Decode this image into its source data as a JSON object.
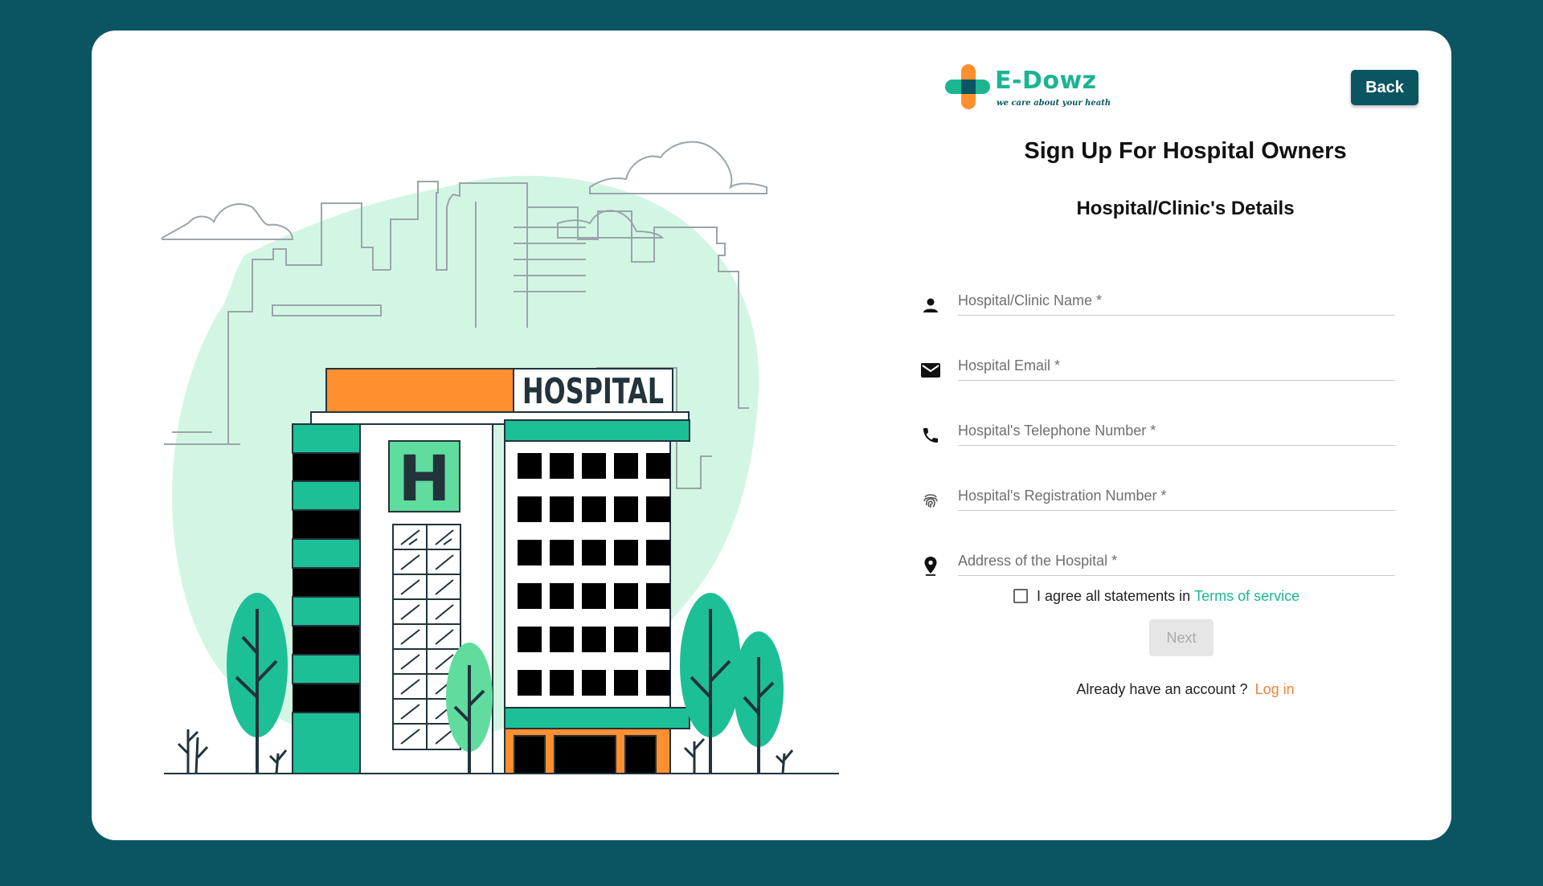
{
  "illustration": {
    "sign_text": "HOSPITAL",
    "h_letter": "H",
    "colors": {
      "teal": "#1dbf96",
      "mint": "#d3f6e4",
      "orange": "#ff8f2f",
      "dark": "#22333b",
      "black": "#000000"
    }
  },
  "brand": {
    "name": "E-Dowz",
    "tagline": "we care about your heath",
    "colors": {
      "teal": "#1bb592",
      "orange": "#ff8f2f",
      "navy": "#0b5563"
    }
  },
  "header": {
    "back_label": "Back"
  },
  "form": {
    "title": "Sign Up For Hospital Owners",
    "section_title": "Hospital/Clinic's Details",
    "fields": [
      {
        "icon": "person-icon",
        "placeholder": "Hospital/Clinic Name *",
        "value": ""
      },
      {
        "icon": "mail-icon",
        "placeholder": "Hospital Email *",
        "value": ""
      },
      {
        "icon": "phone-icon",
        "placeholder": "Hospital's Telephone Number *",
        "value": ""
      },
      {
        "icon": "fingerprint-icon",
        "placeholder": "Hospital's Registration Number *",
        "value": ""
      },
      {
        "icon": "location-pin-icon",
        "placeholder": "Address of the Hospital *",
        "value": ""
      }
    ],
    "agree": {
      "checked": false,
      "text": "I agree all statements in",
      "link": "Terms of service"
    },
    "next_label": "Next",
    "login": {
      "text": "Already have an account ?",
      "link": "Log in"
    }
  }
}
